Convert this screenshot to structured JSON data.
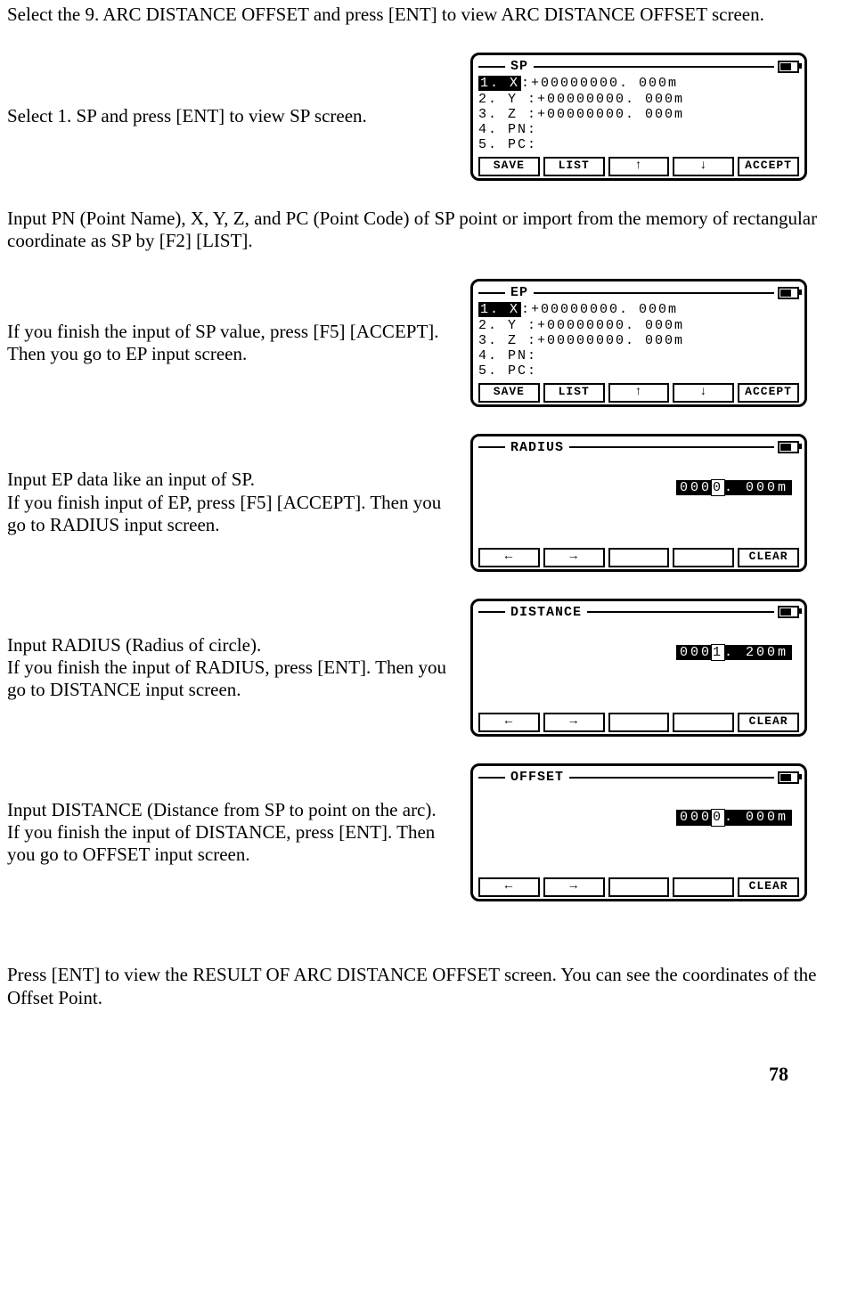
{
  "intro1": "Select the 9. ARC DISTANCE OFFSET and press [ENT] to view ARC DISTANCE OFFSET screen.",
  "step_sp_text": "Select 1. SP and press [ENT] to view SP screen.",
  "step_pn_text": "Input PN (Point Name), X, Y, Z, and PC (Point Code) of SP point or import from the memory of rectangular coordinate as SP by [F2] [LIST].",
  "step_ep_text": "If you finish the input of SP value, press [F5] [ACCEPT]. Then you go to EP input screen.",
  "step_radius_text": "Input EP data like an input of SP.\nIf you finish input of EP, press [F5] [ACCEPT]. Then you go to RADIUS input screen.",
  "step_distance_text": "Input RADIUS (Radius of circle).\nIf you finish the input of RADIUS, press [ENT]. Then you go to DISTANCE input screen.",
  "step_offset_text": "Input DISTANCE (Distance from SP to point on the arc).\nIf you finish the input of DISTANCE, press [ENT]. Then you go to OFFSET input screen.",
  "final_text": "Press [ENT] to view the  RESULT OF ARC DISTANCE OFFSET screen. You can see the coordinates of the Offset Point.",
  "page_number": "78",
  "screens": {
    "sp": {
      "title": "SP",
      "lines": {
        "l1_inv": "1. X",
        "l1_rest": ":+00000000. 000m",
        "l2": "2. Y :+00000000. 000m",
        "l3": "3. Z :+00000000. 000m",
        "l4": "4. PN:",
        "l5": "5. PC:"
      },
      "softkeys": [
        "SAVE",
        "LIST",
        "↑",
        "↓",
        "ACCEPT"
      ]
    },
    "ep": {
      "title": "EP",
      "lines": {
        "l1_inv": "1. X",
        "l1_rest": ":+00000000. 000m",
        "l2": "2. Y :+00000000. 000m",
        "l3": "3. Z :+00000000. 000m",
        "l4": "4. PN:",
        "l5": "5. PC:"
      },
      "softkeys": [
        "SAVE",
        "LIST",
        "↑",
        "↓",
        "ACCEPT"
      ]
    },
    "radius": {
      "title": "RADIUS",
      "value_left": "000",
      "value_cursor": "0",
      "value_right": ". 000m",
      "softkeys": [
        "←",
        "→",
        "",
        "",
        "CLEAR"
      ]
    },
    "distance": {
      "title": "DISTANCE",
      "value_left": "000",
      "value_cursor": "1",
      "value_right": ". 200m",
      "softkeys": [
        "←",
        "→",
        "",
        "",
        "CLEAR"
      ]
    },
    "offset": {
      "title": "OFFSET",
      "value_left": "000",
      "value_cursor": "0",
      "value_right": ". 000m",
      "softkeys": [
        "←",
        "→",
        "",
        "",
        "CLEAR"
      ]
    }
  }
}
